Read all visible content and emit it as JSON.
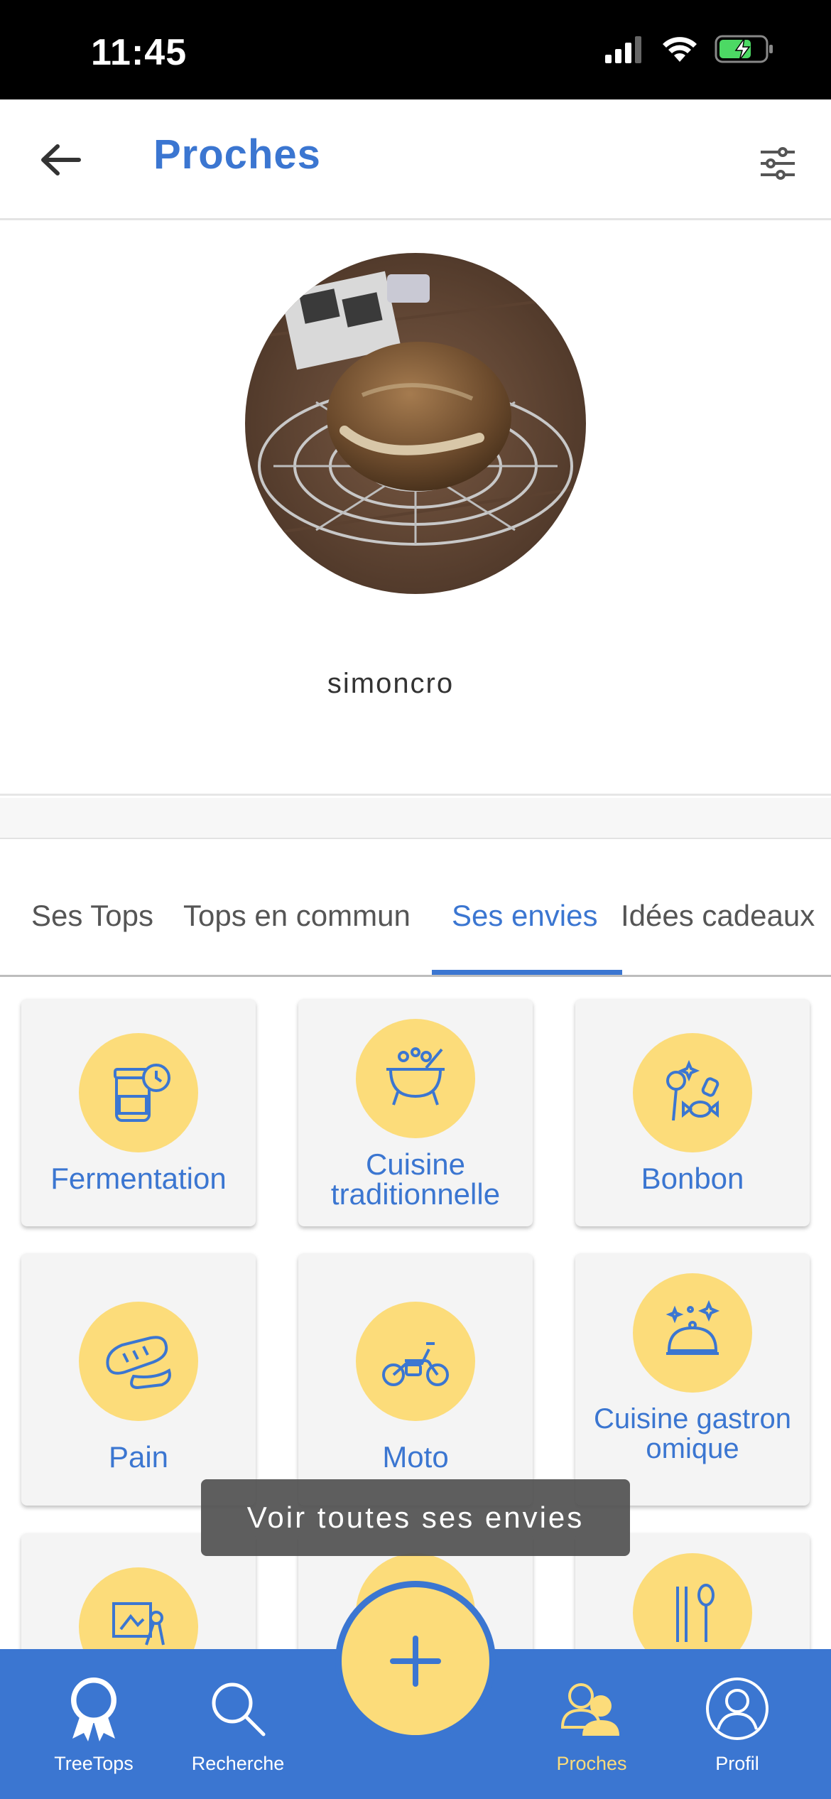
{
  "status_bar": {
    "time": "11:45"
  },
  "header": {
    "title": "Proches"
  },
  "profile": {
    "username": "simoncro"
  },
  "tabs": [
    {
      "label": "Ses Tops",
      "active": false
    },
    {
      "label": "Tops en commun",
      "active": false
    },
    {
      "label": "Ses envies",
      "active": true
    },
    {
      "label": "Idées cadeaux",
      "active": false
    }
  ],
  "cards": [
    {
      "label": "Fermentation",
      "icon": "fermentation-jar-icon"
    },
    {
      "label": "Cuisine traditionnelle",
      "icon": "cauldron-icon"
    },
    {
      "label": "Bonbon",
      "icon": "candy-icon"
    },
    {
      "label": "Pain",
      "icon": "bread-icon"
    },
    {
      "label": "Moto",
      "icon": "motorcycle-icon"
    },
    {
      "label": "Cuisine gastronomique",
      "icon": "cloche-icon"
    },
    {
      "label": "",
      "icon": "drawing-icon"
    },
    {
      "label": "",
      "icon": "unknown-icon"
    },
    {
      "label": "",
      "icon": "utensils-icon"
    }
  ],
  "toast": {
    "text": "Voir toutes ses envies"
  },
  "bottom_nav": {
    "items": [
      {
        "label": "TreeTops",
        "icon": "award-ribbon-icon",
        "active": false
      },
      {
        "label": "Recherche",
        "icon": "search-icon",
        "active": false
      },
      {
        "label": "Proches",
        "icon": "people-icon",
        "active": true
      },
      {
        "label": "Profil",
        "icon": "user-circle-icon",
        "active": false
      }
    ],
    "fab_icon": "plus-icon"
  },
  "colors": {
    "primary_blue": "#3b76d1",
    "accent_yellow": "#fcdc7a",
    "card_bg": "#f4f4f4"
  }
}
